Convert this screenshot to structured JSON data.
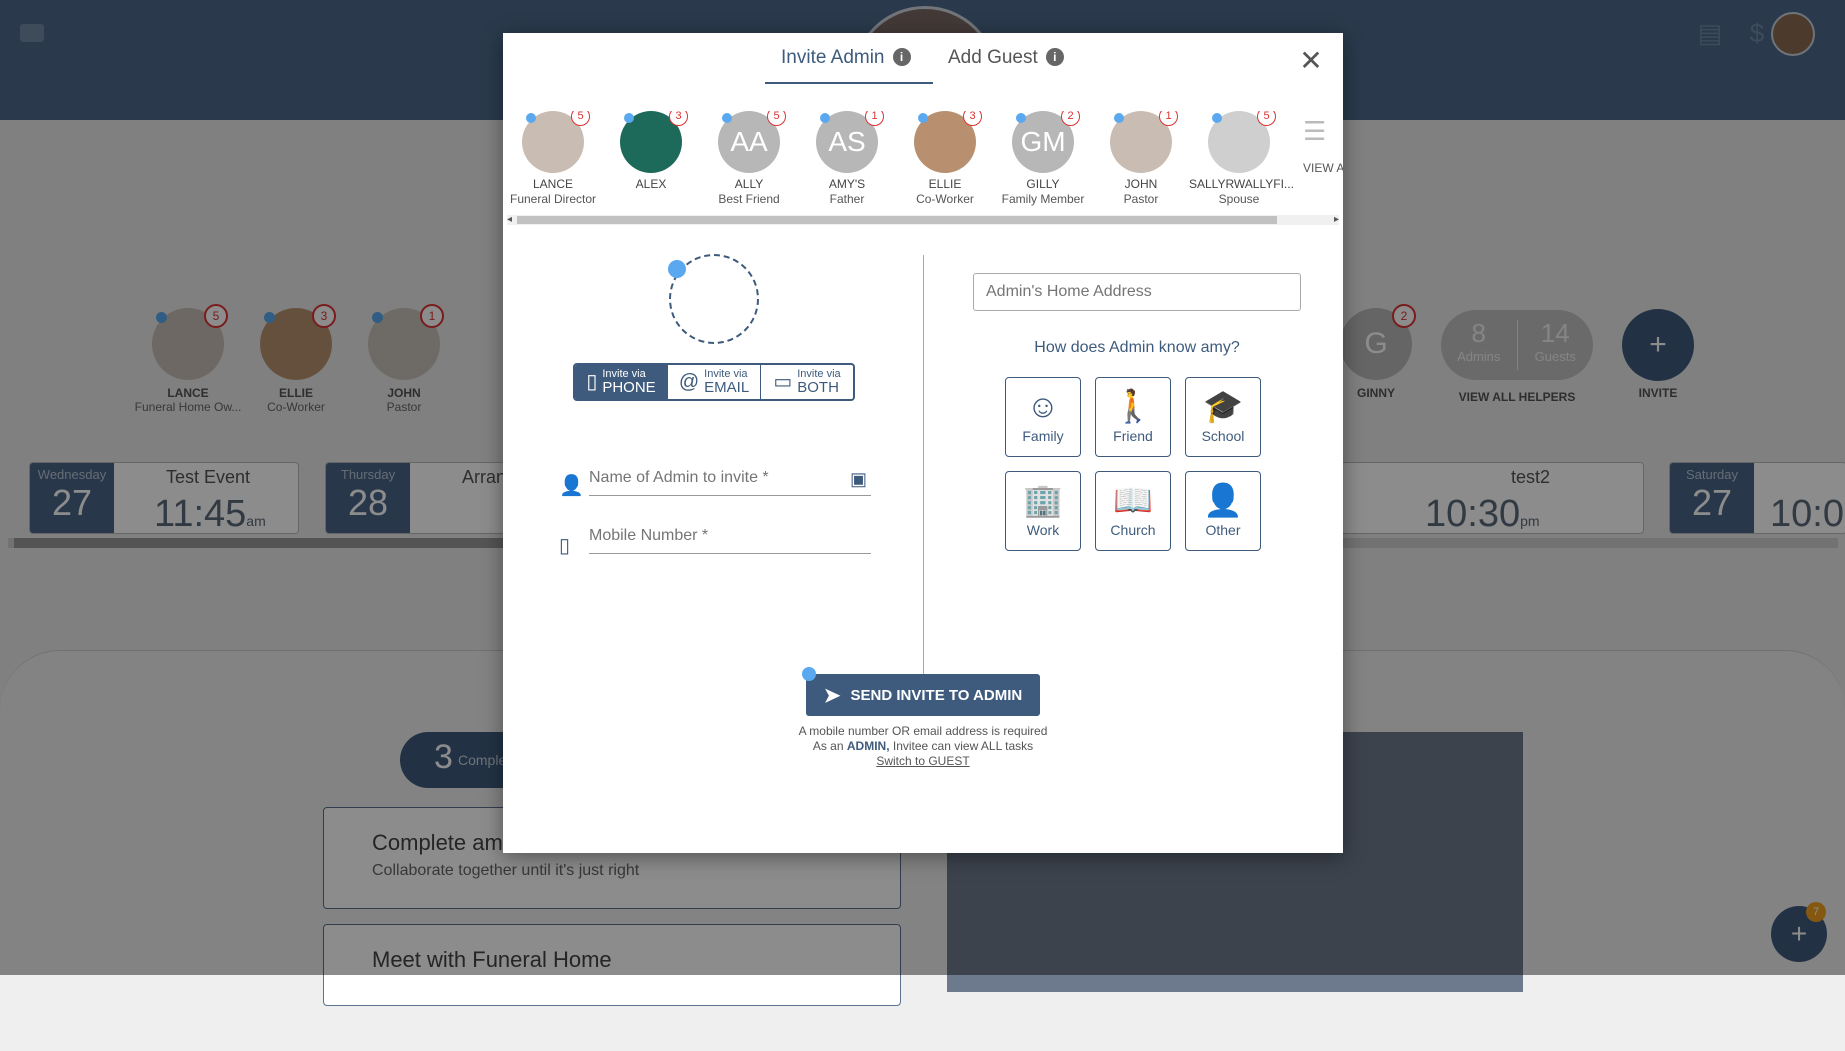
{
  "modal": {
    "tabs": [
      {
        "label": "Invite Admin",
        "active": true
      },
      {
        "label": "Add Guest",
        "active": false
      }
    ],
    "info_glyph": "i",
    "close_glyph": "✕",
    "people": [
      {
        "initials": "",
        "name": "LANCE",
        "role": "Funeral Director",
        "badge": "5",
        "style": "photo"
      },
      {
        "initials": "",
        "name": "ALEX",
        "role": "",
        "badge": "3",
        "style": "photo2"
      },
      {
        "initials": "AA",
        "name": "ALLY",
        "role": "Best Friend",
        "badge": "5",
        "style": "initials"
      },
      {
        "initials": "AS",
        "name": "AMY'S",
        "role": "Father",
        "badge": "1",
        "style": "initials"
      },
      {
        "initials": "",
        "name": "ELLIE",
        "role": "Co-Worker",
        "badge": "3",
        "style": "photo3"
      },
      {
        "initials": "GM",
        "name": "GILLY",
        "role": "Family Member",
        "badge": "2",
        "style": "initials"
      },
      {
        "initials": "",
        "name": "JOHN",
        "role": "Pastor",
        "badge": "1",
        "style": "photo"
      },
      {
        "initials": "",
        "name": "SALLYRWALLYFI...",
        "role": "Spouse",
        "badge": "5",
        "style": "photo4"
      }
    ],
    "view_all_label": "VIEW A",
    "invite_via": [
      {
        "small": "Invite via",
        "big": "PHONE",
        "icon": "▯",
        "active": true
      },
      {
        "small": "Invite via",
        "big": "EMAIL",
        "icon": "@",
        "active": false
      },
      {
        "small": "Invite via",
        "big": "BOTH",
        "icon": "▭",
        "active": false
      }
    ],
    "name_placeholder": "Name of Admin to invite *",
    "mobile_placeholder": "Mobile Number *",
    "address_placeholder": "Admin's Home Address",
    "know_question": "How does Admin know amy?",
    "relationships": [
      {
        "label": "Family",
        "icon": "☺"
      },
      {
        "label": "Friend",
        "icon": "🚶"
      },
      {
        "label": "School",
        "icon": "🎓"
      },
      {
        "label": "Work",
        "icon": "🏢"
      },
      {
        "label": "Church",
        "icon": "📖"
      },
      {
        "label": "Other",
        "icon": "👤"
      }
    ],
    "send_label": "SEND INVITE TO ADMIN",
    "note1": "A mobile number OR email address is required",
    "note2_pre": "As an ",
    "note2_admin": "ADMIN,",
    "note2_post": " Invitee can view ALL tasks",
    "switch_link": "Switch to GUEST"
  },
  "background": {
    "helpers": [
      {
        "initials": "",
        "name": "LANCE",
        "role": "Funeral Home Ow...",
        "badge": "5"
      },
      {
        "initials": "",
        "name": "ELLIE",
        "role": "Co-Worker",
        "badge": "3"
      },
      {
        "initials": "",
        "name": "JOHN",
        "role": "Pastor",
        "badge": "1"
      },
      {
        "initials": "G",
        "name": "GINNY",
        "role": "",
        "badge": "2"
      }
    ],
    "admins_count": "8",
    "admins_label": "Admins",
    "guests_count": "14",
    "guests_label": "Guests",
    "view_all_helpers": "VIEW ALL HELPERS",
    "invite_label": "INVITE",
    "events": [
      {
        "dow": "Wednesday",
        "day": "27",
        "title": "Test Event",
        "time": "11:45",
        "ampm": "am"
      },
      {
        "dow": "Thursday",
        "day": "28",
        "title": "Arran",
        "time": "",
        "ampm": ""
      },
      {
        "dow": "",
        "day": "",
        "title": "test2",
        "time": "10:30",
        "ampm": "pm"
      },
      {
        "dow": "Saturday",
        "day": "27",
        "title": "",
        "time": "10:0",
        "ampm": ""
      }
    ],
    "completed_count": "3",
    "completed_label": "Comple",
    "tasks": [
      {
        "title": "Complete am",
        "subtitle": "Collaborate together until it's just right"
      },
      {
        "title": "Meet with Funeral Home",
        "subtitle": ""
      }
    ],
    "fab_badge": "7"
  }
}
